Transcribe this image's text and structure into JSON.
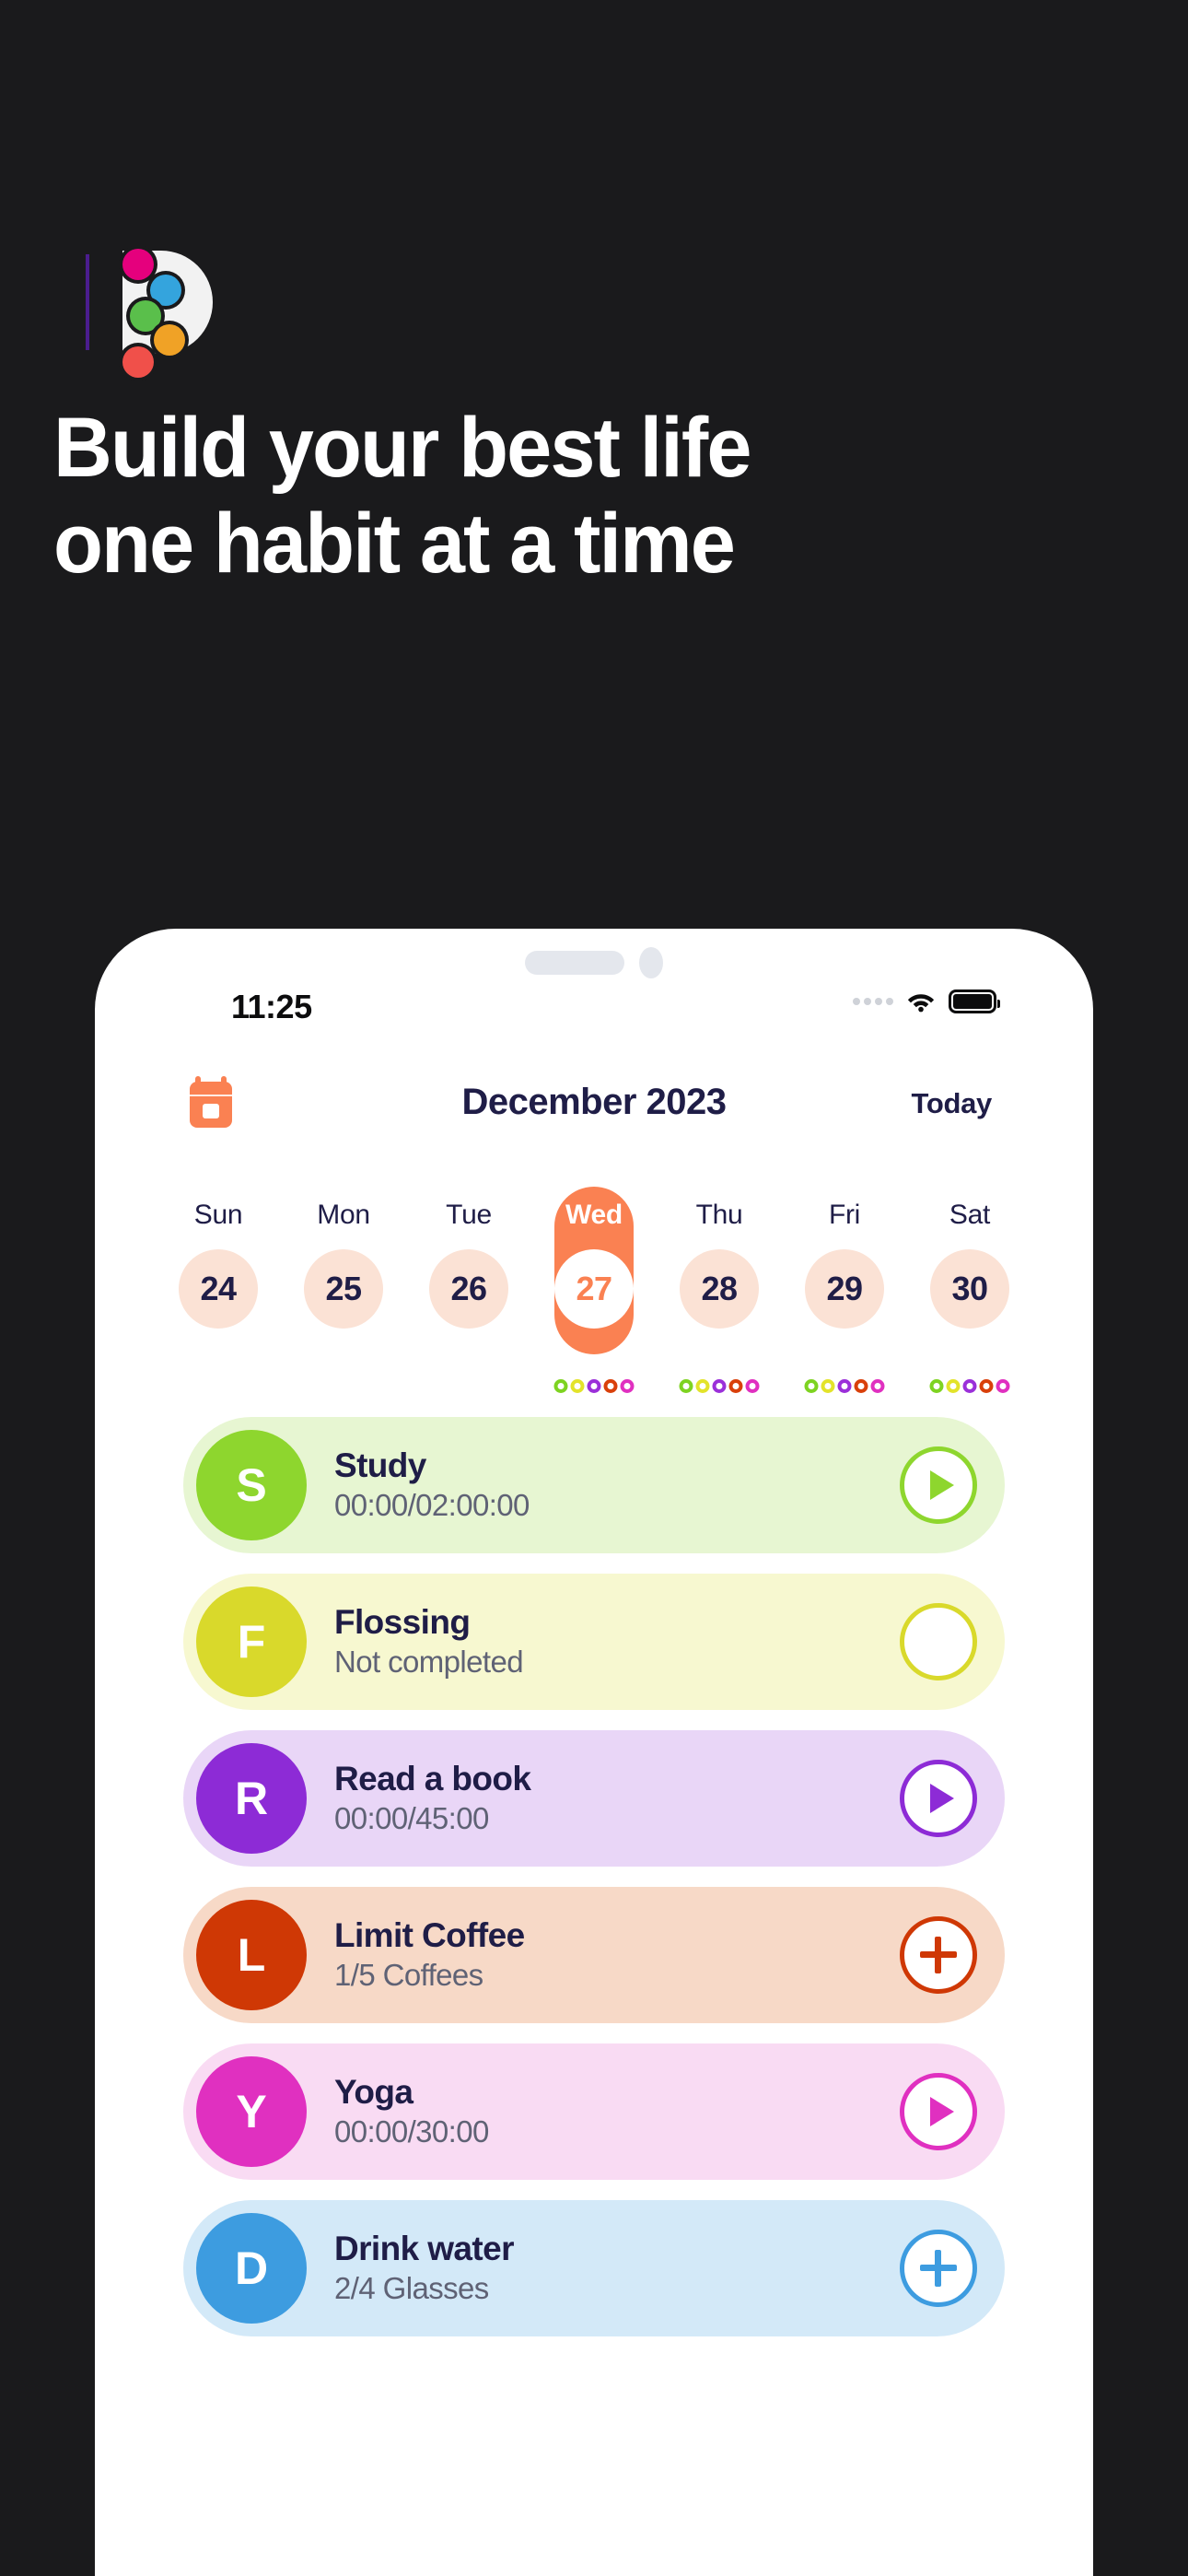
{
  "brand": {
    "logo_name": "brand-logo-d",
    "logo_dots": [
      "#e5007d",
      "#34a4dd",
      "#5abf4b",
      "#f0a226",
      "#f0504a"
    ]
  },
  "headline": {
    "line1": "Build your best life",
    "line2": "one habit at a time"
  },
  "status_bar": {
    "time": "11:25",
    "wifi_icon": "wifi-icon",
    "battery_icon": "battery-icon",
    "cellular_icon": "cellular-dots-icon"
  },
  "calendar_header": {
    "icon": "calendar-icon",
    "title": "December 2023",
    "today_label": "Today"
  },
  "week": {
    "days": [
      {
        "name": "Sun",
        "num": "24",
        "selected": false,
        "dots": []
      },
      {
        "name": "Mon",
        "num": "25",
        "selected": false,
        "dots": []
      },
      {
        "name": "Tue",
        "num": "26",
        "selected": false,
        "dots": []
      },
      {
        "name": "Wed",
        "num": "27",
        "selected": true,
        "dots": [
          "#7ed321",
          "#e3e32a",
          "#9b30d9",
          "#d9400b",
          "#e030c0"
        ]
      },
      {
        "name": "Thu",
        "num": "28",
        "selected": false,
        "dots": [
          "#7ed321",
          "#e3e32a",
          "#9b30d9",
          "#d9400b",
          "#e030c0"
        ]
      },
      {
        "name": "Fri",
        "num": "29",
        "selected": false,
        "dots": [
          "#7ed321",
          "#e3e32a",
          "#9b30d9",
          "#d9400b",
          "#e030c0"
        ]
      },
      {
        "name": "Sat",
        "num": "30",
        "selected": false,
        "dots": [
          "#7ed321",
          "#e3e32a",
          "#9b30d9",
          "#d9400b",
          "#e030c0"
        ]
      }
    ]
  },
  "habits": [
    {
      "initial": "S",
      "title": "Study",
      "subtitle": "00:00/02:00:00",
      "action": "play",
      "card_bg": "#e7f6d2",
      "avatar_bg": "#8ed62e",
      "accent": "#8ed62e"
    },
    {
      "initial": "F",
      "title": "Flossing",
      "subtitle": "Not completed",
      "action": "none",
      "card_bg": "#f7f8d0",
      "avatar_bg": "#d9d92b",
      "accent": "#d9d92b"
    },
    {
      "initial": "R",
      "title": "Read a book",
      "subtitle": "00:00/45:00",
      "action": "play",
      "card_bg": "#e9d6f7",
      "avatar_bg": "#8d2bd6",
      "accent": "#8d2bd6"
    },
    {
      "initial": "L",
      "title": "Limit Coffee",
      "subtitle": "1/5 Coffees",
      "action": "plus",
      "card_bg": "#f7d9c7",
      "avatar_bg": "#cf3805",
      "accent": "#cf3805"
    },
    {
      "initial": "Y",
      "title": "Yoga",
      "subtitle": "00:00/30:00",
      "action": "play",
      "card_bg": "#f9dbf3",
      "avatar_bg": "#e030c0",
      "accent": "#e030c0"
    },
    {
      "initial": "D",
      "title": "Drink water",
      "subtitle": "2/4 Glasses",
      "action": "plus",
      "card_bg": "#d3e9f8",
      "avatar_bg": "#3d9ce0",
      "accent": "#3d9ce0"
    }
  ]
}
